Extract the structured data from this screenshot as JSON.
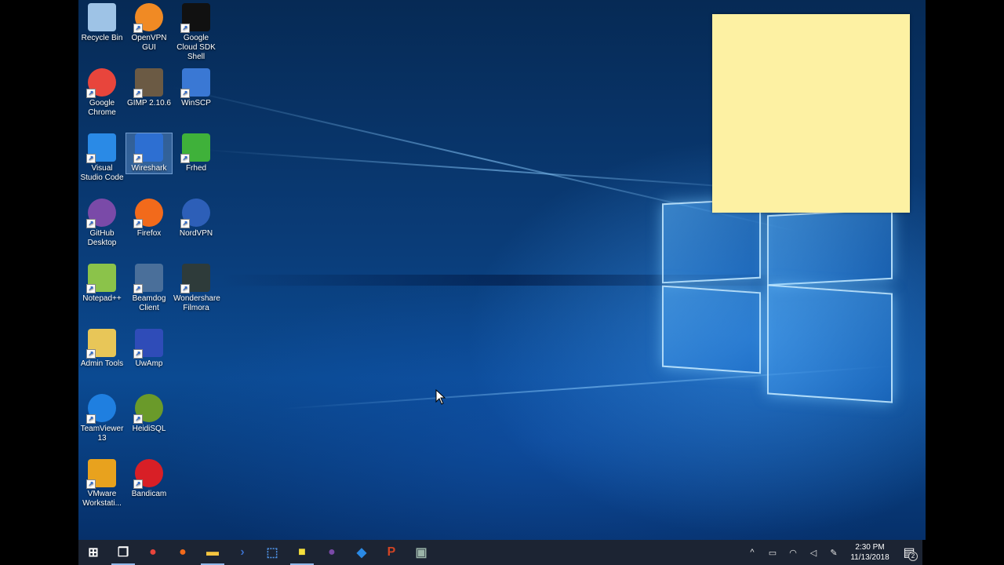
{
  "desktop_icons": [
    {
      "label": "Recycle Bin",
      "icon": "recycle-bin-icon",
      "color": "#9ec3e6"
    },
    {
      "label": "OpenVPN GUI",
      "icon": "openvpn-icon",
      "color": "#f08a24"
    },
    {
      "label": "Google Cloud SDK Shell",
      "icon": "terminal-icon",
      "color": "#111111"
    },
    {
      "label": "Google Chrome",
      "icon": "chrome-icon",
      "color": "#e8453c"
    },
    {
      "label": "GIMP 2.10.6",
      "icon": "gimp-icon",
      "color": "#6b5a44"
    },
    {
      "label": "WinSCP",
      "icon": "winscp-icon",
      "color": "#3a78d4"
    },
    {
      "label": "Visual Studio Code",
      "icon": "vscode-icon",
      "color": "#2a8ae6"
    },
    {
      "label": "Wireshark",
      "icon": "wireshark-icon",
      "color": "#2d6fd2"
    },
    {
      "label": "Frhed",
      "icon": "frhed-icon",
      "color": "#3fb13a"
    },
    {
      "label": "GitHub Desktop",
      "icon": "github-desktop-icon",
      "color": "#7a4aa8"
    },
    {
      "label": "Firefox",
      "icon": "firefox-icon",
      "color": "#f26a1b"
    },
    {
      "label": "NordVPN",
      "icon": "nordvpn-icon",
      "color": "#2d5fb8"
    },
    {
      "label": "Notepad++",
      "icon": "notepadpp-icon",
      "color": "#8bc34a"
    },
    {
      "label": "Beamdog Client",
      "icon": "beamdog-icon",
      "color": "#4a6f9a"
    },
    {
      "label": "Wondershare Filmora",
      "icon": "filmora-icon",
      "color": "#2e3b3a"
    },
    {
      "label": "Admin Tools",
      "icon": "admin-tools-icon",
      "color": "#e8c658"
    },
    {
      "label": "UwAmp",
      "icon": "uwamp-icon",
      "color": "#2f4cb8"
    },
    {
      "label": "TeamViewer 13",
      "icon": "teamviewer-icon",
      "color": "#1f7fe0"
    },
    {
      "label": "HeidiSQL",
      "icon": "heidisql-icon",
      "color": "#6a9a2a"
    },
    {
      "label": "VMware Workstati...",
      "icon": "vmware-icon",
      "color": "#e8a21e"
    },
    {
      "label": "Bandicam",
      "icon": "bandicam-icon",
      "color": "#d81f26"
    }
  ],
  "selected_icon": "Wireshark",
  "taskbar": {
    "pinned": [
      {
        "icon": "start-icon",
        "label": "Start",
        "symbol": "⊞",
        "color": "#ffffff"
      },
      {
        "icon": "task-view-icon",
        "label": "Task View",
        "symbol": "❐",
        "color": "#ffffff"
      },
      {
        "icon": "chrome-icon",
        "label": "Google Chrome",
        "symbol": "●",
        "color": "#e8453c"
      },
      {
        "icon": "firefox-icon",
        "label": "Firefox",
        "symbol": "●",
        "color": "#f26a1b"
      },
      {
        "icon": "file-explorer-icon",
        "label": "File Explorer",
        "symbol": "▬",
        "color": "#f3c440"
      },
      {
        "icon": "powershell-icon",
        "label": "PowerShell",
        "symbol": "›",
        "color": "#3a6ec8"
      },
      {
        "icon": "network-tool-icon",
        "label": "Network",
        "symbol": "⬚",
        "color": "#4d8fe0"
      },
      {
        "icon": "sticky-notes-icon",
        "label": "Sticky Notes",
        "symbol": "■",
        "color": "#f5df3c"
      },
      {
        "icon": "github-desktop-icon",
        "label": "GitHub Desktop",
        "symbol": "●",
        "color": "#7a4aa8"
      },
      {
        "icon": "vscode-icon",
        "label": "Visual Studio Code",
        "symbol": "◆",
        "color": "#2a8ae6"
      },
      {
        "icon": "powerpoint-icon",
        "label": "PowerPoint",
        "symbol": "P",
        "color": "#d04424"
      },
      {
        "icon": "terminal-icon",
        "label": "Terminal",
        "symbol": "▣",
        "color": "#9ab3a8"
      }
    ],
    "active_index": 0,
    "tray": {
      "icons": [
        "chevron-up-icon",
        "battery-icon",
        "wifi-icon",
        "volume-icon",
        "pen-icon"
      ],
      "time": "2:30 PM",
      "date": "11/13/2018",
      "notifications": "2"
    }
  },
  "sticky_note": {
    "color": "#fdf1a3"
  }
}
